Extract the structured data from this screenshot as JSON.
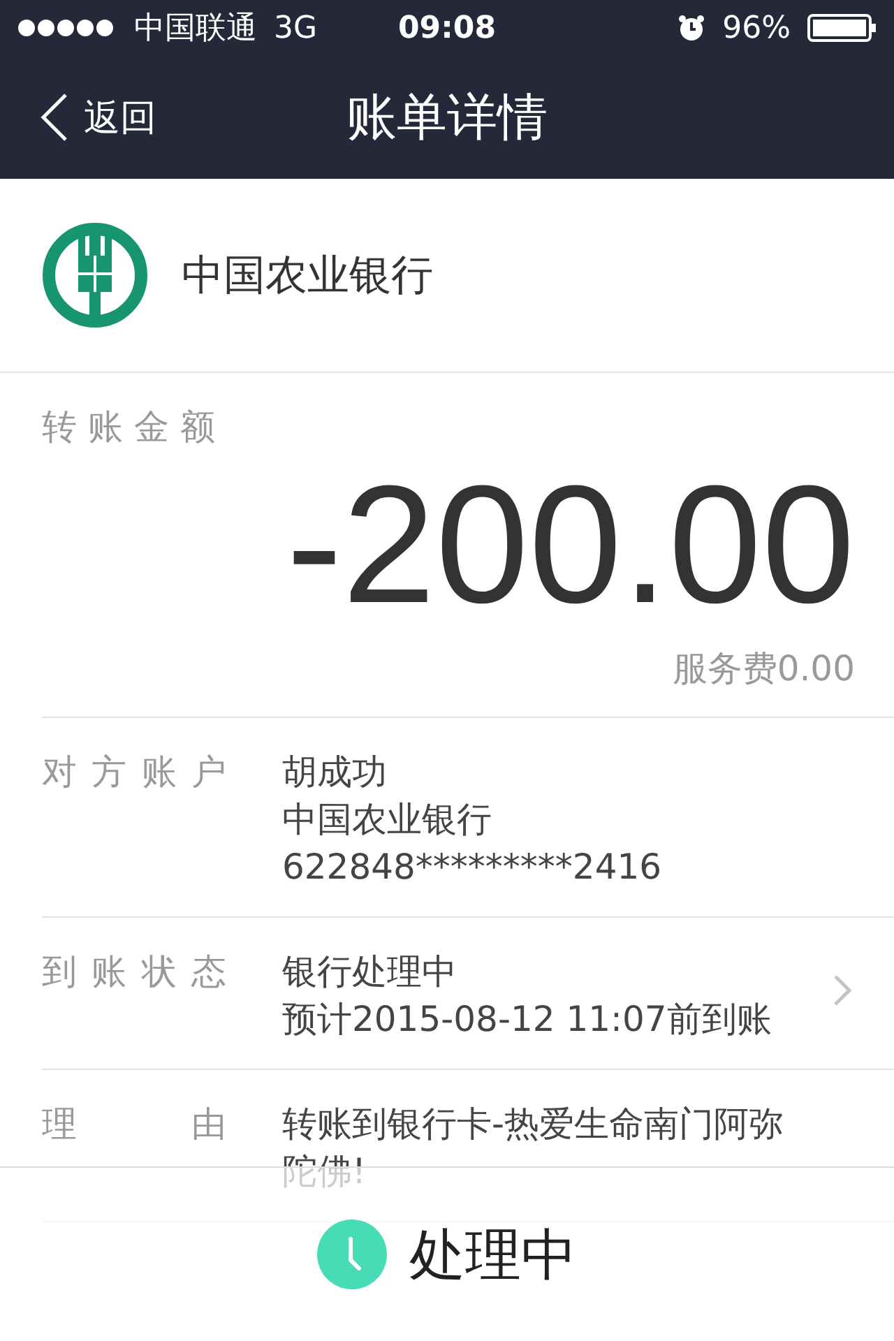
{
  "status_bar": {
    "carrier": "中国联通",
    "network": "3G",
    "time": "09:08",
    "battery": "96%"
  },
  "nav": {
    "back": "返回",
    "title": "账单详情"
  },
  "bank": {
    "name": "中国农业银行"
  },
  "amount": {
    "label": "转账金额",
    "value": "-200.00",
    "fee": "服务费0.00"
  },
  "details": [
    {
      "label": "对方账户",
      "lines": [
        "胡成功",
        "中国农业银行",
        "622848*********2416"
      ],
      "chevron": false
    },
    {
      "label": "到账状态",
      "lines": [
        "银行处理中",
        "预计2015-08-12 11:07前到账"
      ],
      "chevron": true
    },
    {
      "label": "理由",
      "lines": [
        "转账到银行卡-热爱生命南门阿弥",
        "陀佛!"
      ],
      "chevron": false
    }
  ],
  "footer": {
    "status": "处理中"
  }
}
